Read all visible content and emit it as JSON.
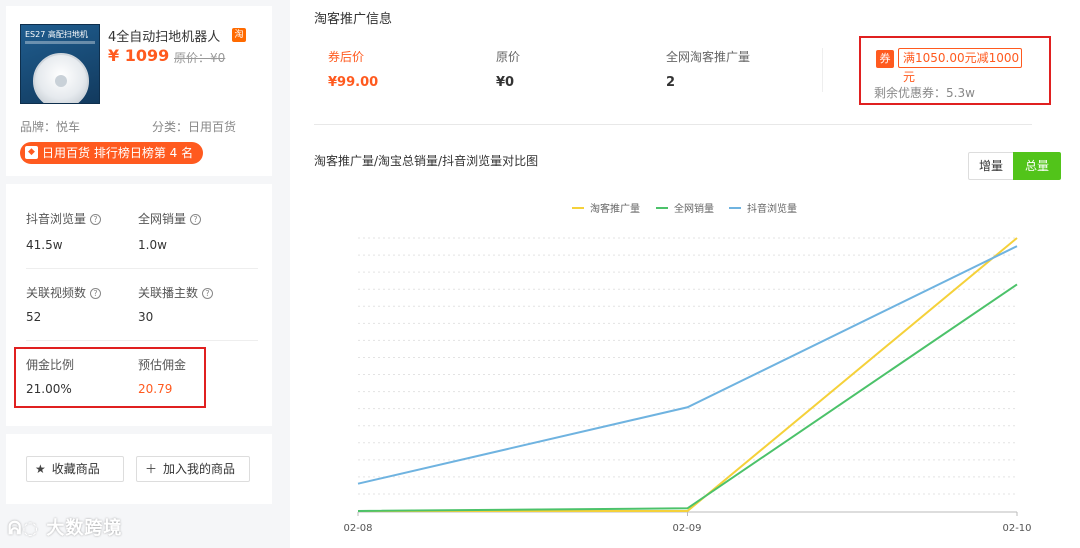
{
  "product": {
    "image_label": "ES27 高配扫地机",
    "title": "4全自动扫地机器人",
    "platform_badge": "淘",
    "price": "¥ 1099",
    "original_price": "原价：¥0",
    "brand": "品牌：悦车",
    "category": "分类：日用百货",
    "rank": "日用百货 排行榜日榜第 4 名"
  },
  "stats": {
    "douyin_views_label": "抖音浏览量",
    "douyin_views_value": "41.5w",
    "network_sales_label": "全网销量",
    "network_sales_value": "1.0w",
    "related_videos_label": "关联视频数",
    "related_videos_value": "52",
    "related_streamers_label": "关联播主数",
    "related_streamers_value": "30",
    "commission_rate_label": "佣金比例",
    "commission_rate_value": "21.00%",
    "estimated_commission_label": "预估佣金",
    "estimated_commission_value": "20.79",
    "help_glyph": "?"
  },
  "actions": {
    "favorite_label": "收藏商品",
    "add_label": "加入我的商品",
    "favorite_icon": "star-icon",
    "add_icon": "plus-icon"
  },
  "watermark": "大数跨境",
  "promo": {
    "section_title": "淘客推广信息",
    "after_coupon_label": "券后价",
    "after_coupon_value": "¥99.00",
    "original_label": "原价",
    "original_value": "¥0",
    "promo_count_label": "全网淘客推广量",
    "promo_count_value": "2",
    "coupon_tag": "券",
    "coupon_text": "满1050.00元减1000",
    "coupon_text_wrap": "元",
    "coupon_remaining": "剩余优惠券：5.3w"
  },
  "chart_section": {
    "title": "淘客推广量/淘宝总销量/抖音浏览量对比图",
    "toggle_increment": "增量",
    "toggle_total": "总量",
    "active_toggle": "总量"
  },
  "colors": {
    "accent": "#ff5a1f",
    "green": "#52c41a",
    "highlight_box": "#e02020"
  },
  "chart_data": {
    "type": "line",
    "title": "淘客推广量/淘宝总销量/抖音浏览量对比图",
    "x": [
      "02-08",
      "02-09",
      "02-10"
    ],
    "grid": true,
    "legend_position": "top-center",
    "series": [
      {
        "name": "淘客推广量",
        "color": "#f5d13a",
        "values": [
          0.0,
          0.0,
          1.0
        ]
      },
      {
        "name": "全网销量",
        "color": "#4cc26a",
        "values": [
          0.0,
          0.01,
          0.83
        ]
      },
      {
        "name": "抖音浏览量",
        "color": "#6fb3e0",
        "values": [
          0.1,
          0.38,
          0.97
        ]
      }
    ]
  }
}
